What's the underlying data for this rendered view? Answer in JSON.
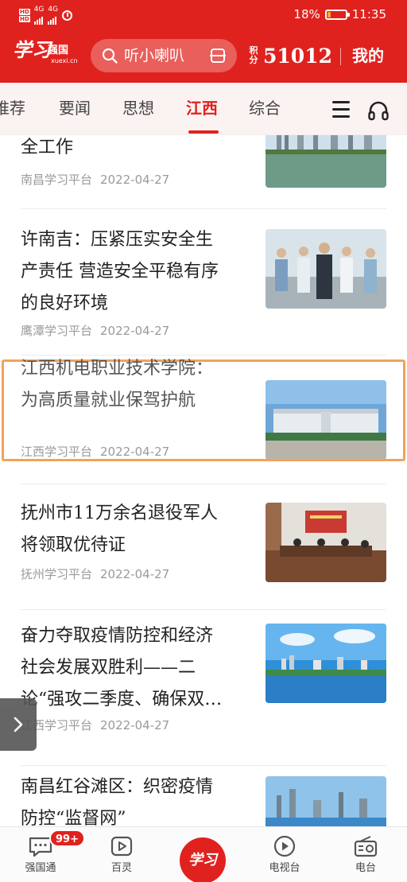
{
  "status_bar": {
    "sim1": "HD",
    "sim2": "HD",
    "net1": "4G",
    "net2": "4G",
    "battery": "18%",
    "battery_level": 0.18,
    "time": "11:35"
  },
  "header": {
    "logo_main": "学习",
    "logo_sub": "强国",
    "logo_url": "xuexi.cn",
    "search_placeholder": "听小喇叭",
    "points_label": "积分",
    "points_value": "51012",
    "mine_label": "我的"
  },
  "tabs": [
    {
      "label": "推荐",
      "active": false
    },
    {
      "label": "要闻",
      "active": false
    },
    {
      "label": "思想",
      "active": false
    },
    {
      "label": "江西",
      "active": true
    },
    {
      "label": "综合",
      "active": false
    }
  ],
  "articles": [
    {
      "title_lines": [
        "全工作"
      ],
      "source": "南昌学习平台",
      "date": "2022-04-27",
      "thumb": "city-lake"
    },
    {
      "title_lines": [
        "许南吉：压紧压实安全生",
        "产责任 营造安全平稳有序",
        "的良好环境"
      ],
      "source": "鹰潭学习平台",
      "date": "2022-04-27",
      "thumb": "officials-inspection"
    },
    {
      "title_lines": [
        "江西机电职业技术学院：",
        "为高质量就业保驾护航"
      ],
      "source": "江西学习平台",
      "date": "2022-04-27",
      "thumb": "college-gate"
    },
    {
      "title_lines": [
        "抚州市11万余名退役军人",
        "将领取优待证"
      ],
      "source": "抚州学习平台",
      "date": "2022-04-27",
      "thumb": "meeting-room"
    },
    {
      "title_lines": [
        "奋力夺取疫情防控和经济",
        "社会发展双胜利——二",
        "论“强攻二季度、确保双…"
      ],
      "source": "江西学习平台",
      "date": "2022-04-27",
      "thumb": "river-city"
    },
    {
      "title_lines": [
        "南昌红谷滩区：织密疫情",
        "防控“监督网”"
      ],
      "source": "",
      "date": "",
      "thumb": "skyline"
    }
  ],
  "bottom_nav": {
    "items": [
      {
        "label": "强国通",
        "icon": "chat-icon"
      },
      {
        "label": "百灵",
        "icon": "play-square-icon"
      },
      {
        "label": "",
        "icon": "xuexi-center-icon"
      },
      {
        "label": "电视台",
        "icon": "tv-play-icon"
      },
      {
        "label": "电台",
        "icon": "radio-icon"
      }
    ],
    "badge": "99+",
    "center_label": "学习"
  },
  "colors": {
    "brand_red": "#e0221e",
    "highlight_border": "#f1a35a",
    "meta_gray": "#9a9a9a"
  }
}
